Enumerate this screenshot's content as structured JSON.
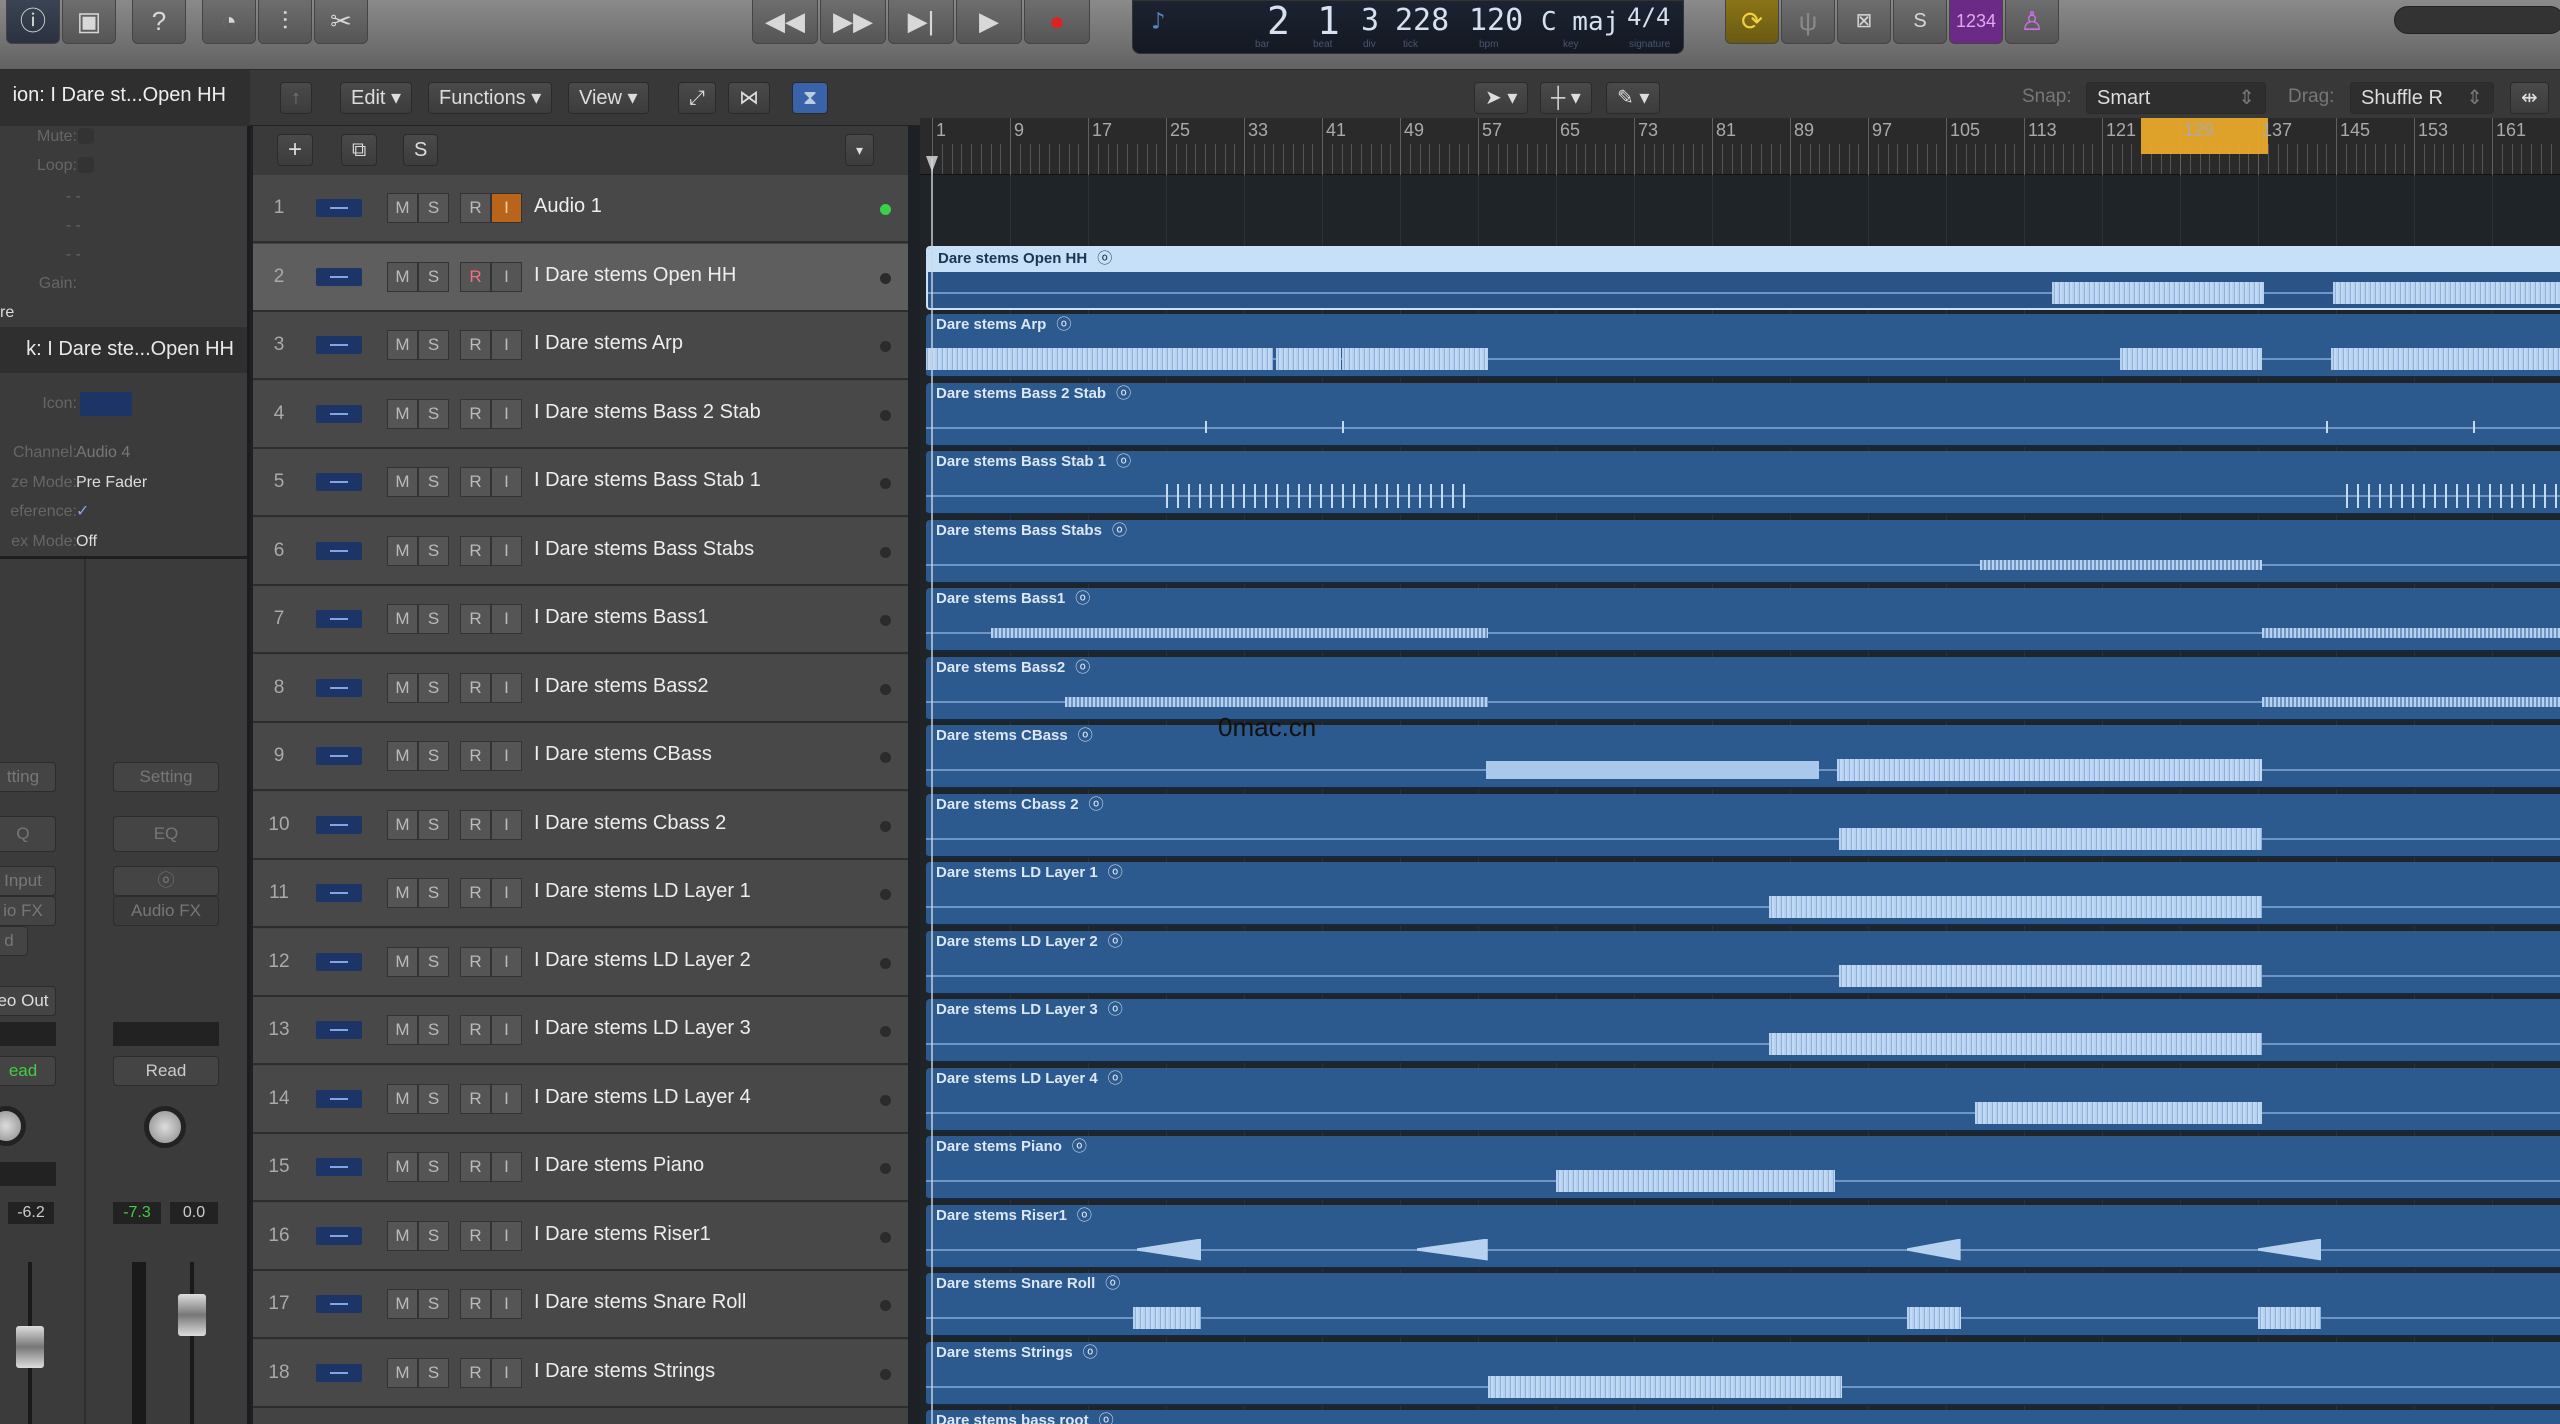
{
  "toolbar": {
    "left_icons": [
      "info-icon",
      "media-browser-icon",
      "help-icon",
      "smart-controls-icon",
      "mixer-icon",
      "scissors-icon"
    ],
    "transport": [
      "rewind-icon",
      "fast-forward-icon",
      "go-to-end-icon",
      "play-icon",
      "record-icon"
    ],
    "lcd": {
      "bar": "2",
      "beat": "1",
      "div": "3",
      "tick": "228",
      "bpm": "120",
      "key": "C maj",
      "signature": "4/4",
      "labels": {
        "bar": "bar",
        "beat": "beat",
        "div": "div",
        "tick": "tick",
        "bpm": "bpm",
        "key": "key",
        "signature": "signature"
      }
    },
    "mode_buttons": {
      "cycle": "cycle-icon",
      "tuner": "tuner-icon",
      "replace": "replace-icon",
      "solo": "S",
      "count_in": "1234",
      "metronome": "metronome-icon"
    },
    "colors": {
      "cycle": "#8a7418",
      "purple": "#6b2a86"
    }
  },
  "subbar": {
    "region_title": "ion: I Dare st...Open HH",
    "edit": "Edit",
    "functions": "Functions",
    "view": "View",
    "snap_label": "Snap:",
    "snap_value": "Smart",
    "drag_label": "Drag:",
    "drag_value": "Shuffle R"
  },
  "inspector": {
    "region": {
      "mute": "Mute:",
      "loop": "Loop:",
      "gain": "Gain:",
      "more": "re",
      "dashes": "- -"
    },
    "track_title": "k:  I Dare ste...Open HH",
    "track": {
      "icon": "Icon:",
      "channel_label": "Channel:",
      "channel": "Audio 4",
      "freeze_label": "ze Mode:",
      "freeze": "Pre Fader",
      "ref_label": "eference:",
      "ref": "✓",
      "flex_label": "ex Mode:",
      "flex": "Off"
    },
    "strip1": {
      "setting": "tting",
      "eq": "Q",
      "input": "Input",
      "fx": "io FX",
      "out": "eo Out",
      "read": "ead",
      "val": "-6.2",
      "send": "d"
    },
    "strip2": {
      "setting": "Setting",
      "eq": "EQ",
      "link": "ⓞ",
      "fx": "Audio FX",
      "read": "Read",
      "val1": "-7.3",
      "val2": "0.0"
    }
  },
  "tracklist": {
    "add": "+",
    "folder": "⧉",
    "s": "S",
    "m": "M",
    "solo": "S",
    "r": "R",
    "i": "I"
  },
  "ruler": {
    "labels": [
      "1",
      "9",
      "17",
      "25",
      "33",
      "41",
      "49",
      "57",
      "65",
      "73",
      "81",
      "89",
      "97",
      "105",
      "113",
      "121",
      "129",
      "137",
      "145",
      "153",
      "161"
    ],
    "cycle_start": 125,
    "cycle_end": 138
  },
  "watermark": "0mac.cn",
  "tracks": [
    {
      "num": "1",
      "name": "Audio 1",
      "region": "",
      "segments": [],
      "input_on": true,
      "led": "#3bd04a"
    },
    {
      "num": "2",
      "name": "I Dare stems  Open HH",
      "region": "Dare stems  Open HH",
      "selected": true,
      "rec_armed_style": true,
      "segments": [
        [
          115.7,
          137.4,
          "wave"
        ],
        [
          144.5,
          170,
          "wave"
        ]
      ]
    },
    {
      "num": "3",
      "name": "I Dare stems Arp",
      "region": "Dare stems Arp",
      "segments": [
        [
          0.3,
          36,
          "wave"
        ],
        [
          36.3,
          43,
          "wave"
        ],
        [
          43,
          58,
          "wave"
        ],
        [
          122.8,
          137.4,
          "wave"
        ],
        [
          144.5,
          170,
          "wave"
        ]
      ]
    },
    {
      "num": "4",
      "name": "I Dare stems Bass 2 Stab",
      "region": "Dare stems Bass 2 Stab",
      "segments": [
        [
          29,
          29.3,
          "tick"
        ],
        [
          43,
          43.3,
          "tick"
        ],
        [
          144,
          144.3,
          "tick"
        ],
        [
          159,
          159.3,
          "tick"
        ]
      ]
    },
    {
      "num": "5",
      "name": "I Dare stems Bass Stab 1",
      "region": "Dare stems Bass Stab 1",
      "segments": [
        [
          25,
          56,
          "stab"
        ],
        [
          146,
          170,
          "stab"
        ]
      ]
    },
    {
      "num": "6",
      "name": "I Dare stems Bass Stabs",
      "region": "Dare stems Bass Stabs",
      "segments": [
        [
          108.5,
          137.4,
          "thin"
        ]
      ]
    },
    {
      "num": "7",
      "name": "I Dare stems Bass1",
      "region": "Dare stems Bass1",
      "segments": [
        [
          7,
          58,
          "thin"
        ],
        [
          137.4,
          170,
          "thin"
        ]
      ]
    },
    {
      "num": "8",
      "name": "I Dare stems Bass2",
      "region": "Dare stems Bass2",
      "segments": [
        [
          14.6,
          58,
          "thin"
        ],
        [
          137.4,
          170,
          "thin"
        ]
      ]
    },
    {
      "num": "9",
      "name": "I Dare stems CBass",
      "region": "Dare stems CBass",
      "segments": [
        [
          57.8,
          92,
          "solid"
        ],
        [
          93.8,
          137.4,
          "wave"
        ]
      ]
    },
    {
      "num": "10",
      "name": "I Dare stems Cbass 2",
      "region": "Dare stems Cbass 2",
      "segments": [
        [
          94,
          137.4,
          "wave"
        ]
      ]
    },
    {
      "num": "11",
      "name": "I Dare stems LD Layer 1",
      "region": "Dare stems LD Layer 1",
      "segments": [
        [
          86.8,
          137.4,
          "wave"
        ]
      ]
    },
    {
      "num": "12",
      "name": "I Dare stems LD Layer 2",
      "region": "Dare stems LD Layer 2",
      "segments": [
        [
          94,
          137.4,
          "wave"
        ]
      ]
    },
    {
      "num": "13",
      "name": "I Dare stems LD Layer 3",
      "region": "Dare stems LD Layer 3",
      "segments": [
        [
          86.8,
          137.4,
          "wave"
        ]
      ]
    },
    {
      "num": "14",
      "name": "I Dare stems LD Layer 4",
      "region": "Dare stems LD Layer 4",
      "segments": [
        [
          108,
          137.4,
          "wave"
        ]
      ]
    },
    {
      "num": "15",
      "name": "I Dare stems Piano",
      "region": "Dare stems Piano",
      "segments": [
        [
          65,
          93.6,
          "wave"
        ]
      ]
    },
    {
      "num": "16",
      "name": "I Dare stems Riser1",
      "region": "Dare stems Riser1",
      "segments": [
        [
          22,
          28.6,
          "riser"
        ],
        [
          50.7,
          58,
          "riser"
        ],
        [
          101,
          106.5,
          "riser"
        ],
        [
          137,
          143.5,
          "riser"
        ]
      ]
    },
    {
      "num": "17",
      "name": "I Dare stems Snare Roll",
      "region": "Dare stems Snare Roll",
      "segments": [
        [
          21.6,
          28.6,
          "wave"
        ],
        [
          101,
          106.5,
          "wave"
        ],
        [
          137,
          143.5,
          "wave"
        ]
      ]
    },
    {
      "num": "18",
      "name": "I Dare stems Strings",
      "region": "Dare stems Strings",
      "segments": [
        [
          58,
          94.3,
          "wave"
        ]
      ]
    },
    {
      "num": "",
      "name": "",
      "region": "Dare stems bass root",
      "segments": []
    }
  ]
}
